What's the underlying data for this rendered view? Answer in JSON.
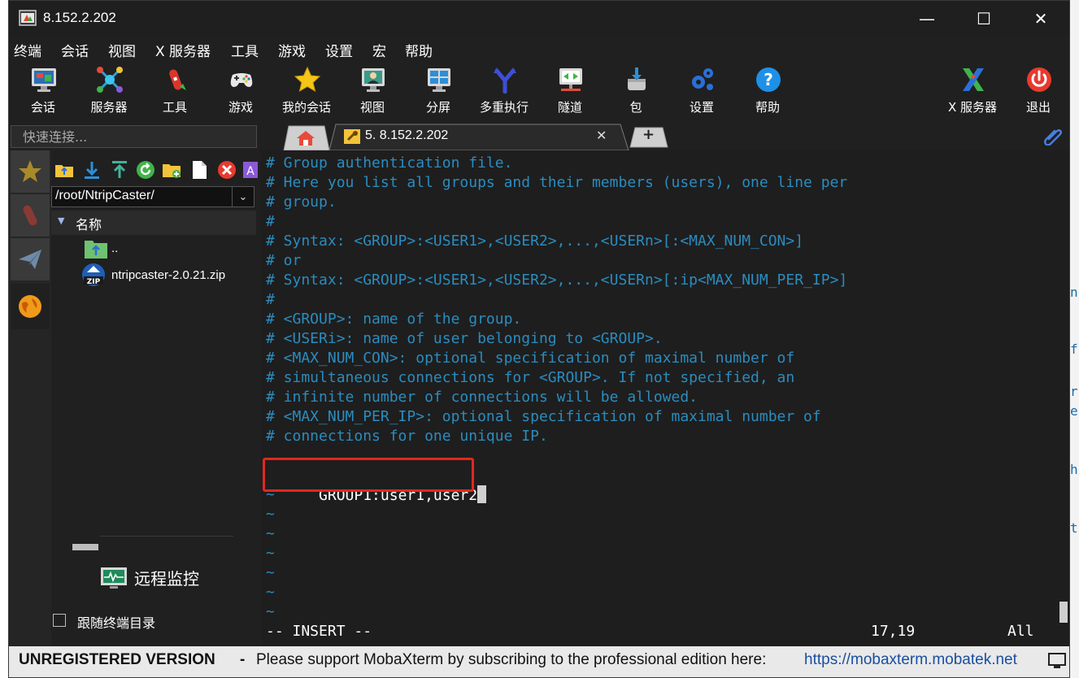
{
  "window": {
    "title": "8.152.2.202",
    "controls": [
      "—",
      "☐",
      "✕"
    ]
  },
  "menu": [
    "终端",
    "会话",
    "视图",
    "X 服务器",
    "工具",
    "游戏",
    "设置",
    "宏",
    "帮助"
  ],
  "toolbar": [
    {
      "label": "会话",
      "icon": "monitor-icon"
    },
    {
      "label": "服务器",
      "icon": "network-icon"
    },
    {
      "label": "工具",
      "icon": "swiss-knife-icon"
    },
    {
      "label": "游戏",
      "icon": "gamepad-icon"
    },
    {
      "label": "我的会话",
      "icon": "star-icon"
    },
    {
      "label": "视图",
      "icon": "user-screen-icon"
    },
    {
      "label": "分屏",
      "icon": "split-screen-icon"
    },
    {
      "label": "多重执行",
      "icon": "fork-icon"
    },
    {
      "label": "隧道",
      "icon": "tunnel-icon"
    },
    {
      "label": "包",
      "icon": "package-icon"
    },
    {
      "label": "设置",
      "icon": "gears-icon"
    },
    {
      "label": "帮助",
      "icon": "help-icon"
    },
    {
      "label": "X 服务器",
      "icon": "x-server-icon"
    },
    {
      "label": "退出",
      "icon": "power-icon"
    }
  ],
  "quick_connect": {
    "placeholder": "快速连接..."
  },
  "tabs": {
    "active_label": "5. 8.152.2.202",
    "close": "✕",
    "add": "+"
  },
  "sftp": {
    "path": "/root/NtripCaster/",
    "column": "名称",
    "files": [
      {
        "name": "..",
        "icon": "parent-folder-icon"
      },
      {
        "name": "ntripcaster-2.0.21.zip",
        "icon": "zip-file-icon"
      }
    ],
    "monitor_label": "远程监控",
    "follow_label": "跟随终端目录"
  },
  "terminal": {
    "lines": [
      "# Group authentication file.",
      "# Here you list all groups and their members (users), one line per",
      "# group.",
      "#",
      "# Syntax: <GROUP>:<USER1>,<USER2>,...,<USERn>[:<MAX_NUM_CON>]",
      "# or",
      "# Syntax: <GROUP>:<USER1>,<USER2>,...,<USERn>[:ip<MAX_NUM_PER_IP>]",
      "#",
      "# <GROUP>: name of the group.",
      "# <USERi>: name of user belonging to <GROUP>.",
      "# <MAX_NUM_CON>: optional specification of maximal number of",
      "# simultaneous connections for <GROUP>. If not specified, an",
      "# infinite number of connections will be allowed.",
      "# <MAX_NUM_PER_IP>: optional specification of maximal number of",
      "# connections for one unique IP."
    ],
    "edit_line": "GROUP1:user1,user2",
    "tildes": [
      "~",
      "~",
      "~",
      "~",
      "~",
      "~",
      "~"
    ],
    "mode": "-- INSERT --",
    "position": "17,19",
    "scroll": "All"
  },
  "statusbar": {
    "prefix": "UNREGISTERED VERSION",
    "dash": "-",
    "message": "Please support MobaXterm by subscribing to the professional edition here:",
    "link": "https://mobaxterm.mobatek.net"
  },
  "colors": {
    "comment": "#2b8cbf",
    "terminal_bg": "#1e1e1e",
    "highlight_border": "#e0281f",
    "link": "#1a4fa0"
  }
}
